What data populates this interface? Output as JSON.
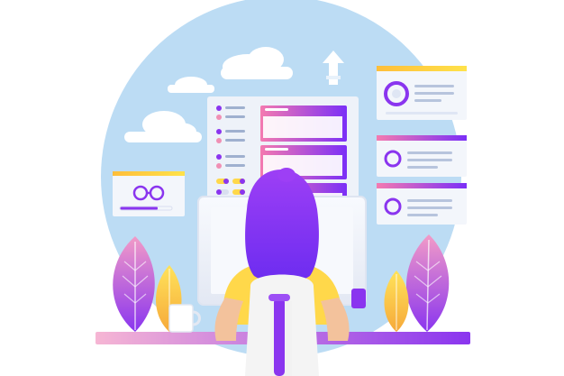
{
  "illustration": {
    "subject": "woman-working-at-computer-with-ui-panels",
    "colors": {
      "sky_circle": "#bcdcf4",
      "cloud": "#ffffff",
      "purple": "#7b2ff7",
      "pink": "#f08fb4",
      "yellow": "#f6d34a",
      "panel": "#f3f6fb",
      "desk": "#f7c6dc",
      "hair": "#8b3ff0",
      "skin": "#f3c29c",
      "shirt": "#ffd84a",
      "chair": "#f4f4f4"
    },
    "icons": [
      "cloud-icon",
      "upload-arrow-icon",
      "glasses-icon",
      "profile-ring-icon",
      "toggle-switch-icon",
      "coffee-mug-icon",
      "leaf-plant-icon"
    ]
  }
}
